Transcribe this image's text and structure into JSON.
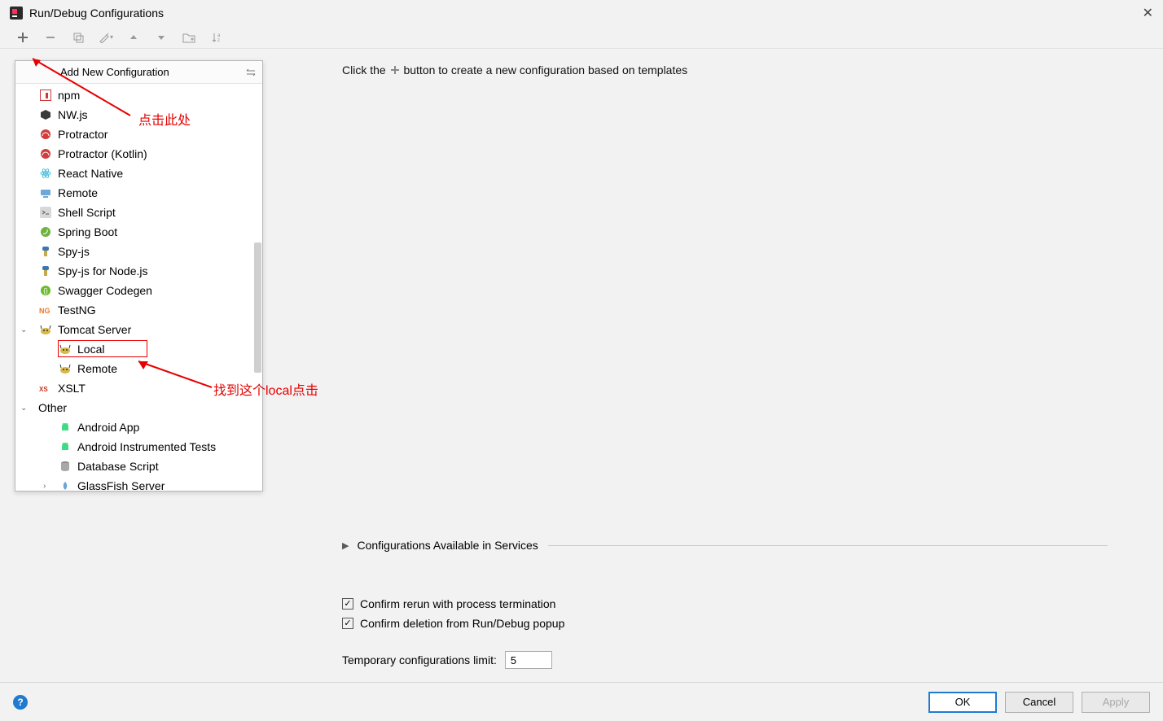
{
  "window": {
    "title": "Run/Debug Configurations"
  },
  "dropdown": {
    "title": "Add New Configuration"
  },
  "tree": {
    "items": [
      {
        "label": "npm",
        "icon": "npm"
      },
      {
        "label": "NW.js",
        "icon": "nwjs"
      },
      {
        "label": "Protractor",
        "icon": "protractor"
      },
      {
        "label": "Protractor (Kotlin)",
        "icon": "protractor"
      },
      {
        "label": "React Native",
        "icon": "react"
      },
      {
        "label": "Remote",
        "icon": "remote"
      },
      {
        "label": "Shell Script",
        "icon": "shell"
      },
      {
        "label": "Spring Boot",
        "icon": "spring"
      },
      {
        "label": "Spy-js",
        "icon": "spyjs"
      },
      {
        "label": "Spy-js for Node.js",
        "icon": "spyjs"
      },
      {
        "label": "Swagger Codegen",
        "icon": "swagger"
      },
      {
        "label": "TestNG",
        "icon": "testng"
      },
      {
        "label": "Tomcat Server",
        "icon": "tomcat",
        "expandable": true,
        "expanded": true
      },
      {
        "label": "Local",
        "icon": "tomcat",
        "child": true,
        "highlighted": true
      },
      {
        "label": "Remote",
        "icon": "tomcat",
        "child": true
      },
      {
        "label": "XSLT",
        "icon": "xslt"
      },
      {
        "label": "Other",
        "expandable": true,
        "expanded": true,
        "noicon": true
      },
      {
        "label": "Android App",
        "icon": "android",
        "grandchild": true
      },
      {
        "label": "Android Instrumented Tests",
        "icon": "android",
        "grandchild": true
      },
      {
        "label": "Database Script",
        "icon": "database",
        "grandchild": true
      },
      {
        "label": "GlassFish Server",
        "icon": "glassfish",
        "grandchild": true,
        "expandable": true
      }
    ]
  },
  "annotations": {
    "a1": "点击此处",
    "a2": "找到这个local点击"
  },
  "main": {
    "hint_pre": "Click the ",
    "hint_post": " button to create a new configuration based on templates",
    "expander": "Configurations Available in Services",
    "confirm_rerun": "Confirm rerun with process termination",
    "confirm_delete": "Confirm deletion from Run/Debug popup",
    "limit_label": "Temporary configurations limit:",
    "limit_value": "5"
  },
  "footer": {
    "ok": "OK",
    "cancel": "Cancel",
    "apply": "Apply"
  }
}
